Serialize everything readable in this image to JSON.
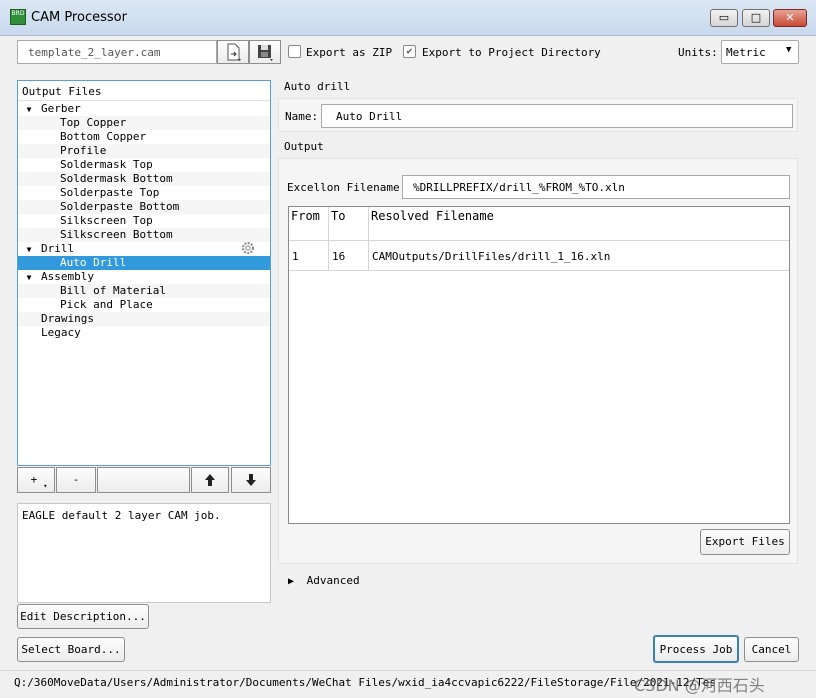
{
  "window": {
    "title": "CAM Processor",
    "minimize_glyph": "▭",
    "maximize_glyph": "□",
    "close_glyph": "✕",
    "icon_text": "BRD"
  },
  "toolbar": {
    "template_filename": "template_2_layer.cam",
    "new_icon": "new-file-icon",
    "save_icon": "save-icon",
    "export_zip_label": "Export as ZIP",
    "export_zip_checked": false,
    "export_project_label": "Export to Project Directory",
    "export_project_checked": true,
    "units_label": "Units:",
    "units_value": "Metric"
  },
  "tree": {
    "header": "Output Files",
    "items": [
      {
        "label": "Gerber",
        "level": 0,
        "expanded": true
      },
      {
        "label": "Top Copper",
        "level": 1
      },
      {
        "label": "Bottom Copper",
        "level": 1
      },
      {
        "label": "Profile",
        "level": 1
      },
      {
        "label": "Soldermask Top",
        "level": 1
      },
      {
        "label": "Soldermask Bottom",
        "level": 1
      },
      {
        "label": "Solderpaste Top",
        "level": 1
      },
      {
        "label": "Solderpaste Bottom",
        "level": 1
      },
      {
        "label": "Silkscreen Top",
        "level": 1
      },
      {
        "label": "Silkscreen Bottom",
        "level": 1
      },
      {
        "label": "Drill",
        "level": 0,
        "expanded": true
      },
      {
        "label": "Auto Drill",
        "level": 1,
        "selected": true
      },
      {
        "label": "Assembly",
        "level": 0,
        "expanded": true
      },
      {
        "label": "Bill of Material",
        "level": 1
      },
      {
        "label": "Pick and Place",
        "level": 1
      },
      {
        "label": "Drawings",
        "level": 0
      },
      {
        "label": "Legacy",
        "level": 0
      }
    ],
    "add_label": "+",
    "add_arrow": "▾",
    "remove_label": "-",
    "up_glyph": "🡅",
    "down_glyph": "🡇"
  },
  "description": {
    "text": "EAGLE default 2 layer CAM job.",
    "edit_button": "Edit Description...",
    "select_board_button": "Select Board..."
  },
  "right": {
    "section_title": "Auto drill",
    "name_label": "Name:",
    "name_value": "Auto Drill",
    "output_title": "Output",
    "excellon_label": "Excellon Filename:",
    "excellon_value": "%DRILLPREFIX/drill_%FROM_%TO.xln",
    "table_headers": {
      "from": "From",
      "to": "To",
      "resolved": "Resolved Filename"
    },
    "table_rows": [
      {
        "from": "1",
        "to": "16",
        "resolved": "CAMOutputs/DrillFiles/drill_1_16.xln"
      }
    ],
    "export_files_button": "Export Files",
    "advanced_label": "Advanced"
  },
  "footer": {
    "process_job_button": "Process Job",
    "cancel_button": "Cancel",
    "status_path": "Q:/360MoveData/Users/Administrator/Documents/WeChat Files/wxid_ia4ccvapic6222/FileStorage/File/2021-12/Test1.brd",
    "watermark": "CSDN @河西石头"
  },
  "colors": {
    "selection": "#3399dd",
    "tree_border": "#5a9fd4",
    "process_border": "#3c7fb1"
  }
}
